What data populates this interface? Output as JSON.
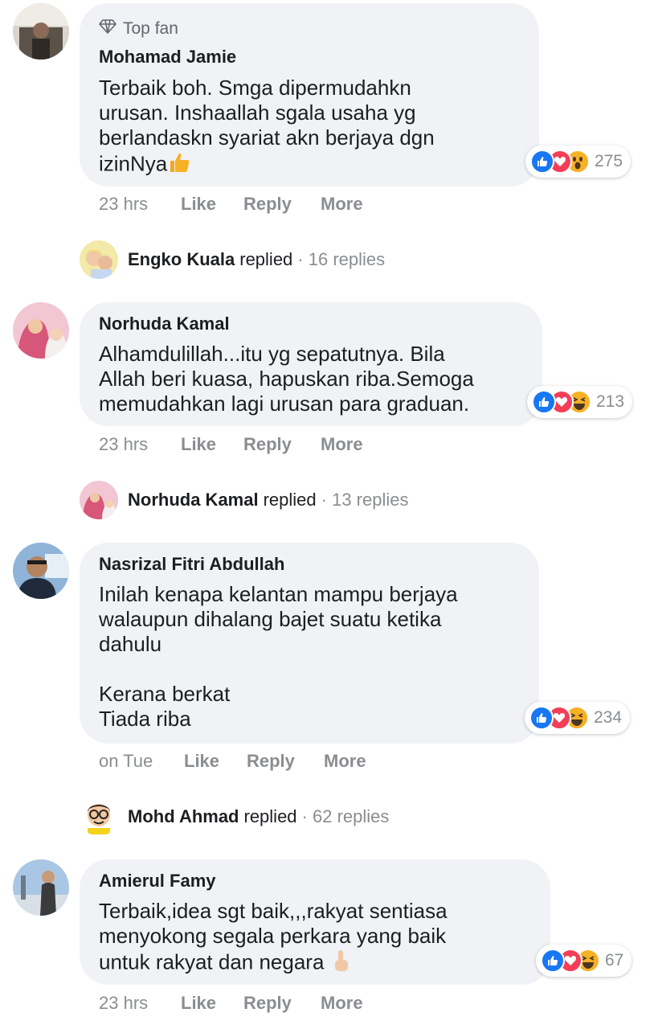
{
  "comments": [
    {
      "badge": "Top fan",
      "name": "Mohamad Jamie",
      "text": "Terbaik boh. Smga dipermudahkn\nurusan. Inshaallah sgala usaha yg\nberlandaskn syariat akn berjaya dgn\nizinNya",
      "inline_emoji": "thumbs-up-emoji",
      "reaction_count": "275",
      "reaction_icons": [
        "like-icon",
        "love-icon",
        "wow-icon"
      ],
      "time": "23 hrs",
      "like": "Like",
      "reply": "Reply",
      "more": "More",
      "replied": {
        "name": "Engko Kuala",
        "verb": "replied",
        "count": "· 16 replies"
      }
    },
    {
      "name": "Norhuda Kamal",
      "text": "Alhamdulillah...itu yg sepatutnya. Bila\nAllah beri kuasa, hapuskan riba.Semoga\nmemudahkan lagi urusan para graduan.",
      "reaction_count": "213",
      "reaction_icons": [
        "like-icon",
        "love-icon",
        "haha-icon"
      ],
      "time": "23 hrs",
      "like": "Like",
      "reply": "Reply",
      "more": "More",
      "replied": {
        "name": "Norhuda Kamal",
        "verb": "replied",
        "count": "· 13 replies"
      }
    },
    {
      "name": "Nasrizal Fitri Abdullah",
      "text": "Inilah kenapa kelantan mampu berjaya\nwalaupun dihalang bajet suatu ketika\ndahulu\n\nKerana berkat\nTiada riba",
      "reaction_count": "234",
      "reaction_icons": [
        "like-icon",
        "love-icon",
        "haha-icon"
      ],
      "time": "on Tue",
      "like": "Like",
      "reply": "Reply",
      "more": "More",
      "replied": {
        "name": "Mohd Ahmad",
        "verb": "replied",
        "count": "· 62 replies"
      }
    },
    {
      "name": "Amierul Famy",
      "text": "Terbaik,idea sgt baik,,,rakyat sentiasa\nmenyokong segala perkara yang baik\nuntuk rakyat dan negara",
      "inline_emoji": "index-pointing-up-emoji",
      "reaction_count": "67",
      "reaction_icons": [
        "like-icon",
        "love-icon",
        "haha-icon"
      ],
      "time": "23 hrs",
      "like": "Like",
      "reply": "Reply",
      "more": "More"
    }
  ],
  "colors": {
    "bubble": "#f0f2f5",
    "like": "#1877f2",
    "love": "#f33e58",
    "emoji": "#f7b125",
    "meta": "#8a8d91"
  }
}
